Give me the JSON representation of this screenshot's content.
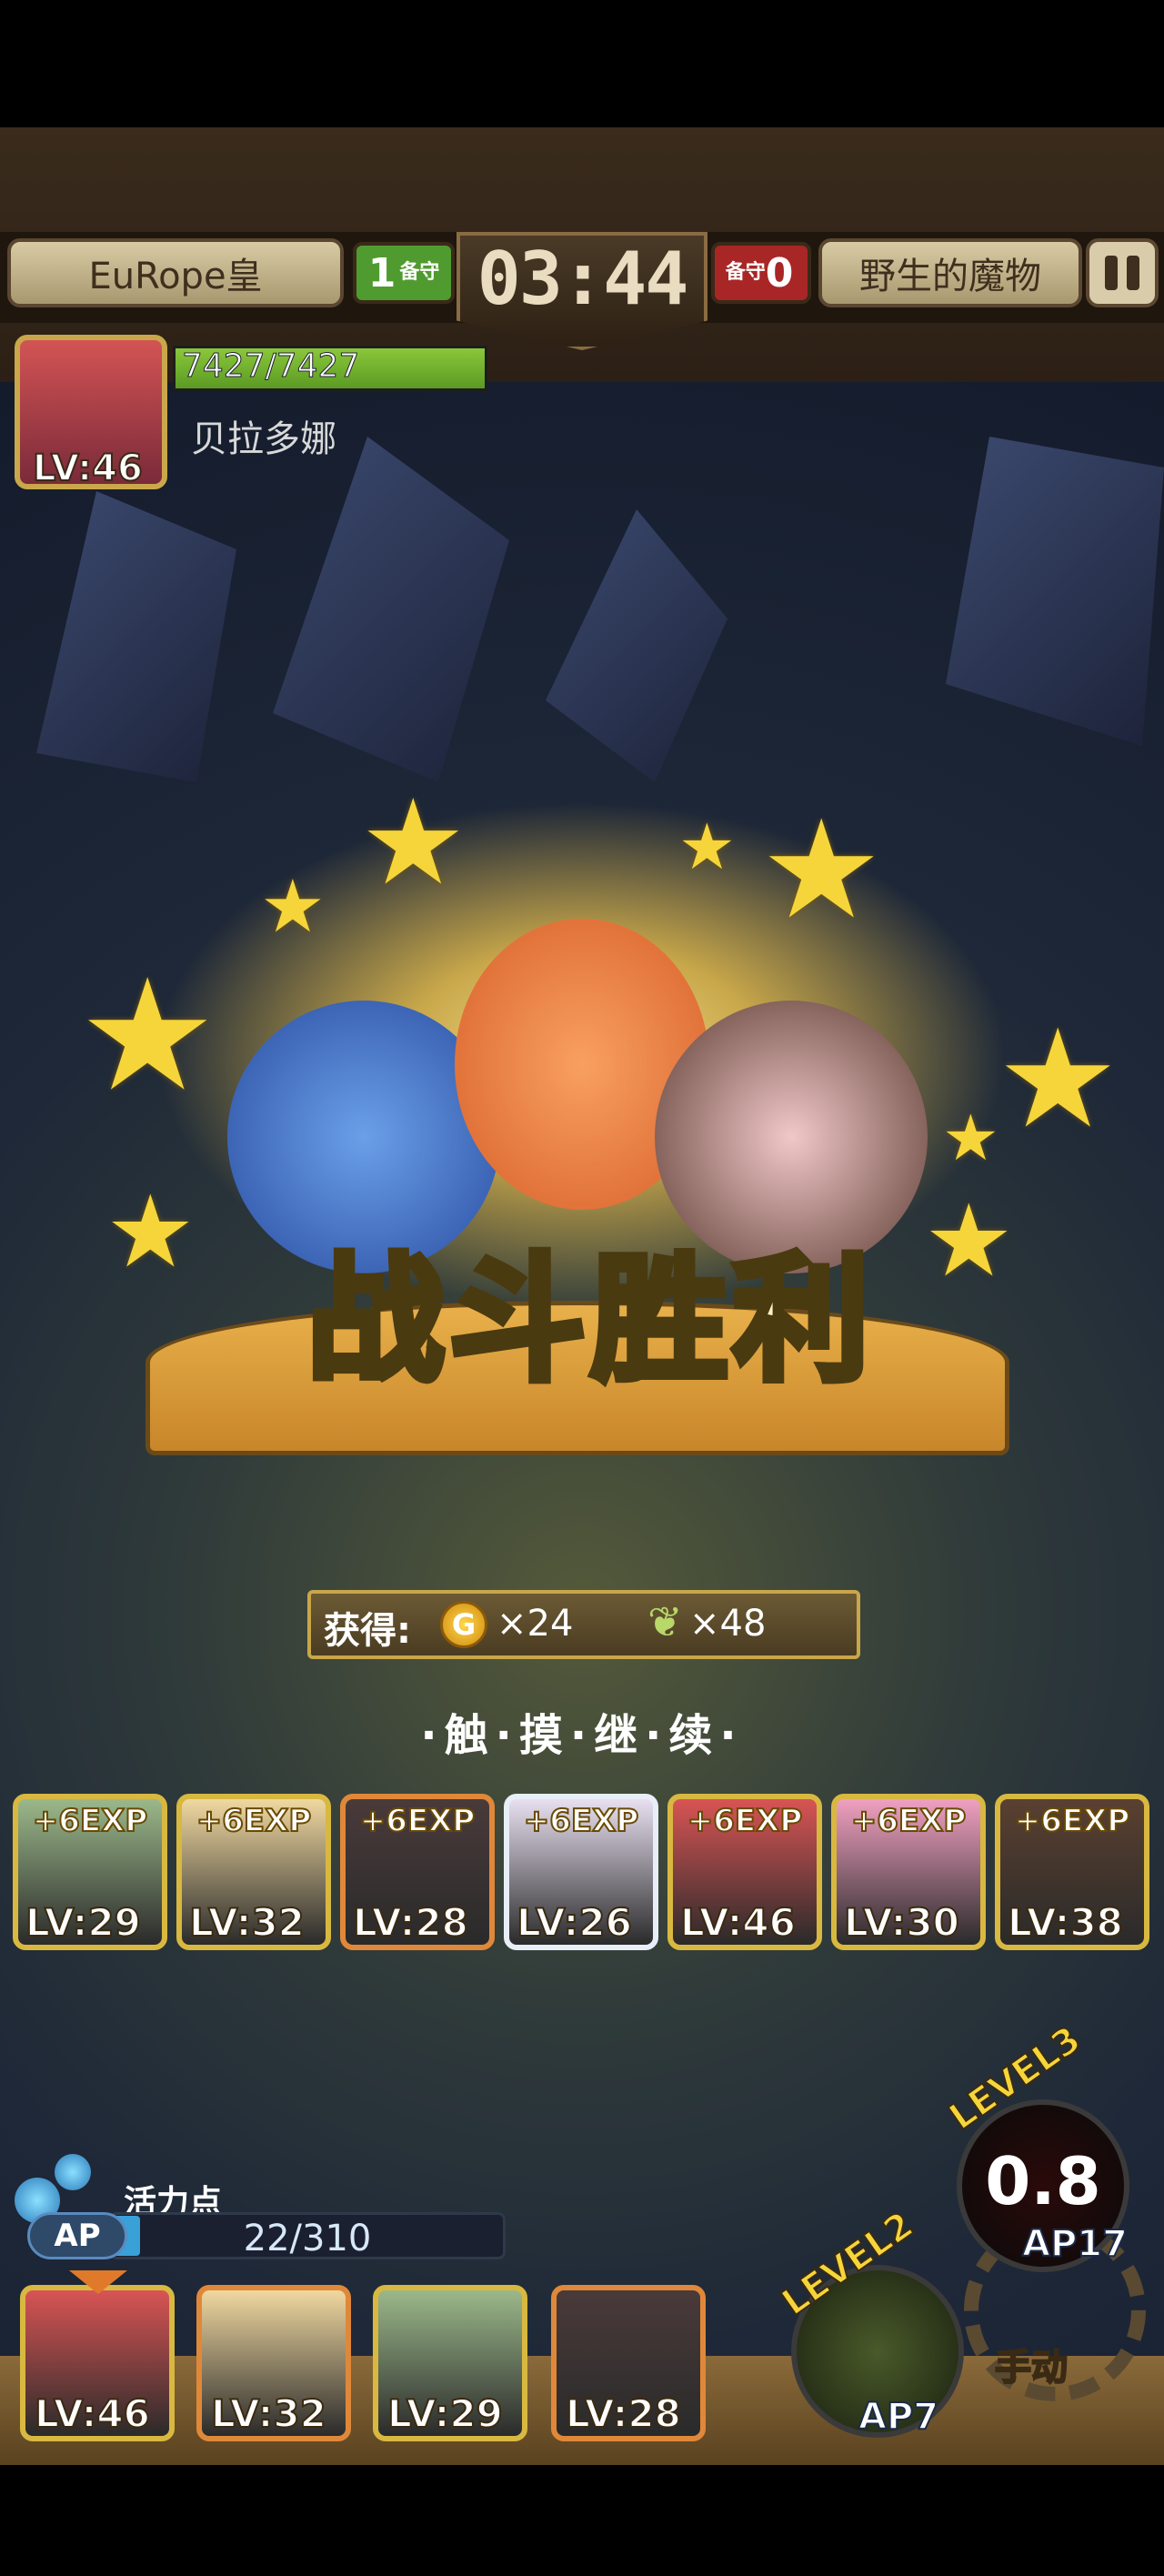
{
  "hud": {
    "team_left": "EuRope皇",
    "guard_left_count": "1",
    "guard_left_label": "备守",
    "timer": "03:44",
    "guard_right_count": "0",
    "guard_right_label": "备守",
    "team_right": "野生的魔物"
  },
  "boss": {
    "hp": "7427/7427",
    "hp_fraction": 1.0,
    "name": "贝拉多娜",
    "level": "LV:46"
  },
  "victory": {
    "title": "战斗胜利",
    "reward_label": "获得:",
    "gold_symbol": "G",
    "gold_amount": "×24",
    "feather_amount": "×48",
    "continue": "·触·摸·继·续·"
  },
  "exp_cards": [
    {
      "exp": "+6EXP",
      "level": "LV:29",
      "color": "#9bb88a"
    },
    {
      "exp": "+6EXP",
      "level": "LV:32",
      "color": "#f0d8a0"
    },
    {
      "exp": "+6EXP",
      "level": "LV:28",
      "color": "#4a3a3a"
    },
    {
      "exp": "+6EXP",
      "level": "LV:26",
      "color": "#e8e0f0"
    },
    {
      "exp": "+6EXP",
      "level": "LV:46",
      "color": "#d85454"
    },
    {
      "exp": "+6EXP",
      "level": "LV:30",
      "color": "#f0a0c0"
    },
    {
      "exp": "+6EXP",
      "level": "LV:38",
      "color": "#5a4030"
    }
  ],
  "ap": {
    "label": "活力点",
    "tag": "AP",
    "value": "22/310",
    "fraction": 0.071
  },
  "party": [
    {
      "level": "LV:46",
      "color": "#d85454"
    },
    {
      "level": "LV:32",
      "color": "#f0d8a0"
    },
    {
      "level": "LV:29",
      "color": "#9bb88a"
    },
    {
      "level": "LV:28",
      "color": "#4a3a3a"
    }
  ],
  "skills": {
    "skill3_level": "LEVEL3",
    "skill3_value": "0.8",
    "skill3_ap": "AP17",
    "skill2_level": "LEVEL2",
    "skill2_ap": "AP7",
    "manual": "手动"
  }
}
